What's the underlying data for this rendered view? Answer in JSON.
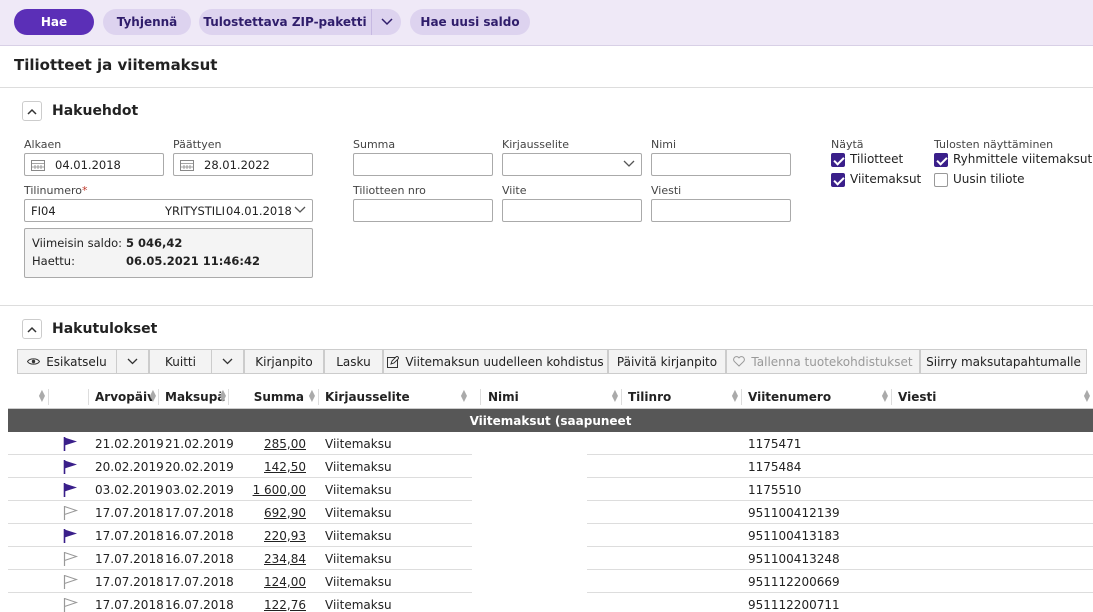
{
  "toolbar": {
    "search_label": "Hae",
    "clear_label": "Tyhjennä",
    "zip_label": "Tulostettava ZIP-paketti",
    "new_balance_label": "Hae uusi saldo"
  },
  "page": {
    "title": "Tiliotteet ja viitemaksut"
  },
  "criteria": {
    "section_title": "Hakuehdot",
    "start_label": "Alkaen",
    "start_value": "04.01.2018",
    "end_label": "Päättyen",
    "end_value": "28.01.2022",
    "account_label": "Tilinumero",
    "account_required": "*",
    "account_value": "FI04",
    "account_name": "YRITYSTILI",
    "account_date": "04.01.2018",
    "sum_label": "Summa",
    "sum_value": "",
    "entry_label": "Kirjausselite",
    "entry_value": "",
    "name_label": "Nimi",
    "name_value": "",
    "statement_no_label": "Tiliotteen nro",
    "statement_no_value": "",
    "reference_label": "Viite",
    "reference_value": "",
    "message_label": "Viesti",
    "message_value": "",
    "balance_key": "Viimeisin saldo:",
    "balance_value": "5 046,42",
    "fetched_key": "Haettu:",
    "fetched_value": "06.05.2021 11:46:42",
    "show_label": "Näytä",
    "show_statements_label": "Tiliotteet",
    "show_statements_checked": true,
    "show_payments_label": "Viitemaksut",
    "show_payments_checked": true,
    "print_label": "Tulosten näyttäminen",
    "group_payments_label": "Ryhmittele viitemaksut",
    "group_payments_checked": true,
    "latest_statement_label": "Uusin tiliote",
    "latest_statement_checked": false
  },
  "results": {
    "section_title": "Hakutulokset",
    "actions": {
      "preview": "Esikatselu",
      "receipt": "Kuitti",
      "bookkeeping": "Kirjanpito",
      "invoice": "Lasku",
      "reallocate": "Viitemaksun uudelleen kohdistus",
      "update_bookkeeping": "Päivitä kirjanpito",
      "save_allocations": "Tallenna tuotekohdistukset",
      "go_to_payment": "Siirry maksutapahtumalle"
    },
    "columns": {
      "value_date": "Arvopäiv",
      "pay_date": "Maksupä",
      "amount": "Summa",
      "entry": "Kirjausselite",
      "name": "Nimi",
      "account": "Tilinro",
      "reference": "Viitenumero",
      "message": "Viesti"
    },
    "group_title": "Viitemaksut (saapuneet",
    "rows": [
      {
        "flag": "filled",
        "value_date": "21.02.2019",
        "pay_date": "21.02.2019",
        "amount": "285,00",
        "entry": "Viitemaksu",
        "reference": "1175471"
      },
      {
        "flag": "filled",
        "value_date": "20.02.2019",
        "pay_date": "20.02.2019",
        "amount": "142,50",
        "entry": "Viitemaksu",
        "reference": "1175484"
      },
      {
        "flag": "filled",
        "value_date": "03.02.2019",
        "pay_date": "03.02.2019",
        "amount": "1 600,00",
        "entry": "Viitemaksu",
        "reference": "1175510"
      },
      {
        "flag": "outline",
        "value_date": "17.07.2018",
        "pay_date": "17.07.2018",
        "amount": "692,90",
        "entry": "Viitemaksu",
        "reference": "951100412139"
      },
      {
        "flag": "filled",
        "value_date": "17.07.2018",
        "pay_date": "16.07.2018",
        "amount": "220,93",
        "entry": "Viitemaksu",
        "reference": "951100413183"
      },
      {
        "flag": "outline",
        "value_date": "17.07.2018",
        "pay_date": "16.07.2018",
        "amount": "234,84",
        "entry": "Viitemaksu",
        "reference": "951100413248"
      },
      {
        "flag": "outline",
        "value_date": "17.07.2018",
        "pay_date": "17.07.2018",
        "amount": "124,00",
        "entry": "Viitemaksu",
        "reference": "951112200669"
      },
      {
        "flag": "outline",
        "value_date": "17.07.2018",
        "pay_date": "16.07.2018",
        "amount": "122,76",
        "entry": "Viitemaksu",
        "reference": "951112200711"
      }
    ]
  },
  "colors": {
    "primary": "#5b2fb7",
    "flag": "#3a1f8a",
    "group_row": "#575757"
  }
}
